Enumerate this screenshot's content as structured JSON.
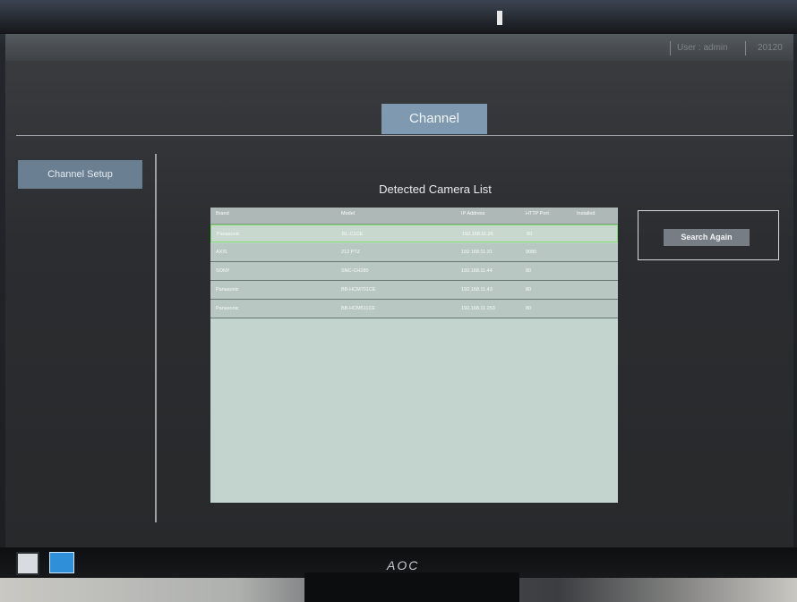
{
  "topbar": {
    "user_label": "User : admin",
    "extra_label": "20120"
  },
  "header": {
    "title": "Channel"
  },
  "sidebar": {
    "items": [
      {
        "label": "Channel Setup"
      }
    ]
  },
  "main": {
    "list_title": "Detected Camera List",
    "columns": [
      "Brand",
      "Model",
      "IP Address",
      "HTTP Port",
      "Installed"
    ],
    "rows": [
      {
        "brand": "Panasonic",
        "model": "BL-C1CE",
        "ip": "192.168.11.26",
        "port": "80",
        "installed": "",
        "selected": true
      },
      {
        "brand": "AXIS",
        "model": "212 PTZ",
        "ip": "192.168.11.31",
        "port": "9080",
        "installed": ""
      },
      {
        "brand": "SONY",
        "model": "SNC-CH280",
        "ip": "192.168.11.44",
        "port": "80",
        "installed": ""
      },
      {
        "brand": "Panasonic",
        "model": "BB-HCM701CE",
        "ip": "192.168.11.43",
        "port": "80",
        "installed": ""
      },
      {
        "brand": "Panasonic",
        "model": "BB-HCM511CE",
        "ip": "192.168.11.253",
        "port": "80",
        "installed": ""
      }
    ],
    "search_again_label": "Search Again"
  },
  "monitor": {
    "brand": "AOC"
  },
  "colors": {
    "accent": "#7f99b0",
    "selection_border": "#7be06c",
    "panel": "#c3d3ce"
  }
}
